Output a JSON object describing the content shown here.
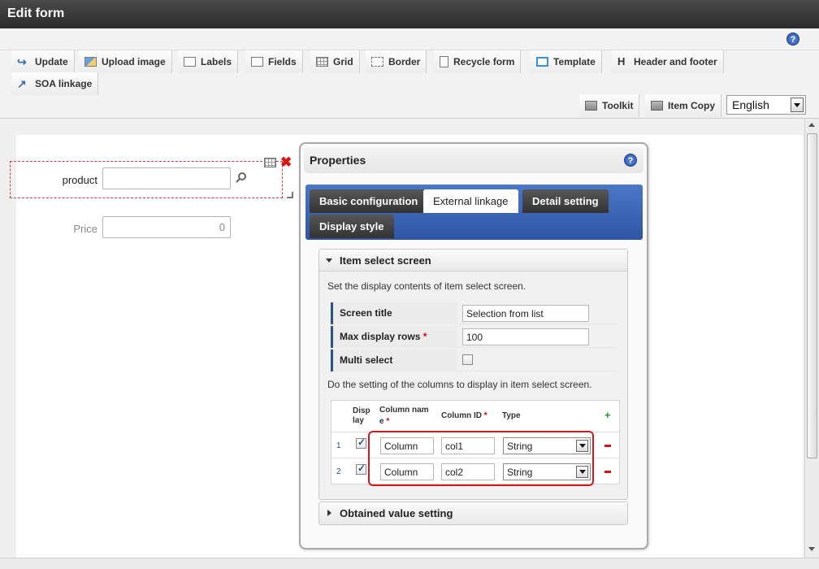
{
  "window": {
    "title": "Edit form"
  },
  "toolbar": {
    "row1": [
      {
        "label": "Update",
        "icon": "update-icon"
      },
      {
        "label": "Upload image",
        "icon": "upload-image-icon"
      },
      {
        "label": "Labels",
        "icon": "labels-icon"
      },
      {
        "label": "Fields",
        "icon": "fields-icon"
      },
      {
        "label": "Grid",
        "icon": "grid-icon"
      },
      {
        "label": "Border",
        "icon": "border-icon"
      },
      {
        "label": "Recycle form",
        "icon": "recycle-form-icon"
      },
      {
        "label": "Template",
        "icon": "template-icon"
      },
      {
        "label": "Header and footer",
        "icon": "header-footer-icon"
      }
    ],
    "row2": [
      {
        "label": "SOA linkage",
        "icon": "soa-linkage-icon"
      }
    ],
    "right": [
      {
        "label": "Toolkit",
        "icon": "toolkit-icon"
      },
      {
        "label": "Item Copy",
        "icon": "item-copy-icon"
      }
    ],
    "language": "English"
  },
  "form": {
    "product_label": "product",
    "product_value": "",
    "price_label": "Price",
    "price_value": "0"
  },
  "properties": {
    "title": "Properties",
    "tabs": [
      "Basic configuration",
      "External linkage",
      "Detail setting",
      "Display style"
    ],
    "active_tab": "External linkage",
    "item_select": {
      "title": "Item select screen",
      "desc1": "Set the display contents of item select screen.",
      "screen_title_label": "Screen title",
      "screen_title_value": "Selection from list",
      "max_rows_label": "Max display rows",
      "max_rows_value": "100",
      "multi_select_label": "Multi select",
      "multi_select_checked": false,
      "desc2": "Do the setting of the columns to display in item select screen.",
      "columns_header": {
        "display_line1": "Disp",
        "display_line2": "lay",
        "name_line1": "Column nam",
        "name_line2": "e",
        "id": "Column ID",
        "type": "Type",
        "required_mark": "*",
        "add": "+"
      },
      "columns": [
        {
          "no": "1",
          "display": true,
          "name": "Column",
          "id": "col1",
          "type": "String"
        },
        {
          "no": "2",
          "display": true,
          "name": "Column",
          "id": "col2",
          "type": "String"
        }
      ]
    },
    "obtained": {
      "title": "Obtained value setting"
    }
  }
}
